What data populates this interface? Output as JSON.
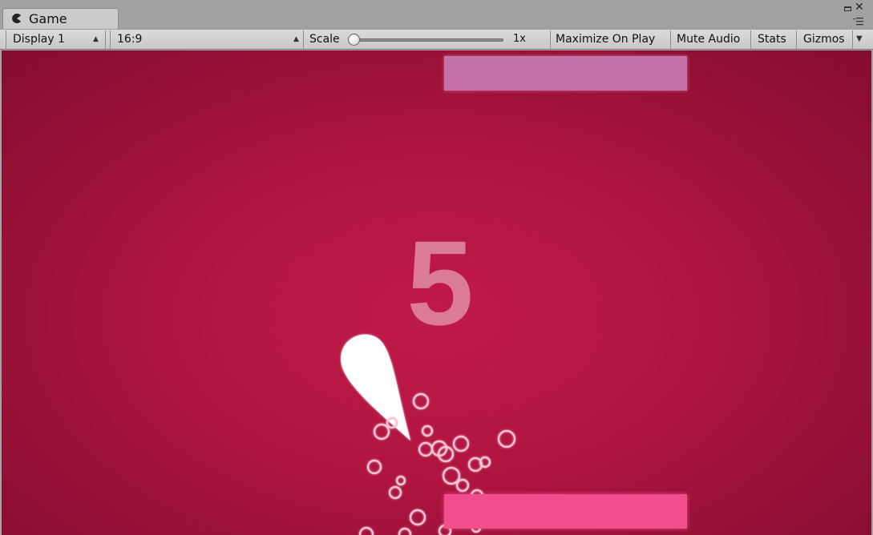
{
  "tab": {
    "title": "Game"
  },
  "toolbar": {
    "display": "Display 1",
    "aspect": "16:9",
    "scale_label": "Scale",
    "scale_value": "1x",
    "maximize_on_play": "Maximize On Play",
    "mute_audio": "Mute Audio",
    "stats": "Stats",
    "gizmos": "Gizmos"
  },
  "game": {
    "score": "5",
    "colors": {
      "background": "#b01540",
      "top_paddle": "#c472a8",
      "bottom_paddle": "#f24d8c",
      "score": "#dc7b97",
      "ball": "#ffffff"
    }
  }
}
